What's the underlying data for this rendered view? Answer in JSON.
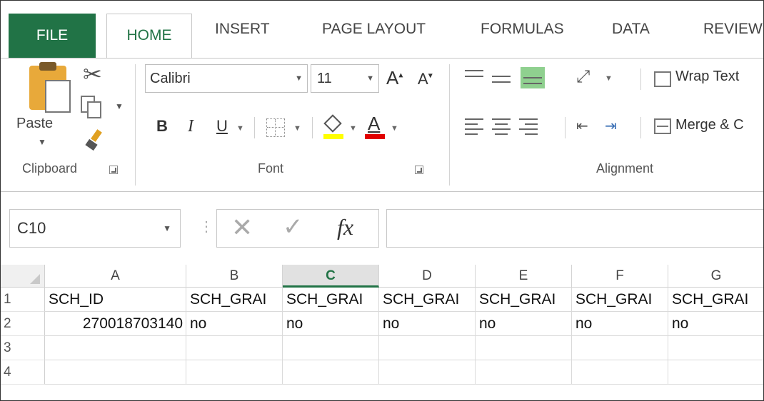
{
  "tabs": [
    "FILE",
    "HOME",
    "INSERT",
    "PAGE LAYOUT",
    "FORMULAS",
    "DATA",
    "REVIEW"
  ],
  "ribbon": {
    "clipboard": {
      "paste_label": "Paste",
      "group_label": "Clipboard"
    },
    "font": {
      "font_name": "Calibri",
      "font_size": "11",
      "bold": "B",
      "italic": "I",
      "underline": "U",
      "grow": "A",
      "shrink": "A",
      "font_color_letter": "A",
      "group_label": "Font",
      "fill_color": "#ffff00",
      "font_color": "#e00000"
    },
    "alignment": {
      "wrap_text": "Wrap Text",
      "merge": "Merge & C",
      "group_label": "Alignment"
    }
  },
  "formula_bar": {
    "name_box": "C10",
    "fx": "fx",
    "content": ""
  },
  "sheet": {
    "columns": [
      "A",
      "B",
      "C",
      "D",
      "E",
      "F",
      "G"
    ],
    "selected_column": "C",
    "rows": [
      {
        "num": "1",
        "cells": [
          "SCH_ID",
          "SCH_GRAI",
          "SCH_GRAI",
          "SCH_GRAI",
          "SCH_GRAI",
          "SCH_GRAI",
          "SCH_GRAI"
        ]
      },
      {
        "num": "2",
        "cells": [
          "270018703140",
          "no",
          "no",
          "no",
          "no",
          "no",
          "no"
        ]
      },
      {
        "num": "3",
        "cells": [
          "",
          "",
          "",
          "",
          "",
          "",
          ""
        ]
      },
      {
        "num": "4",
        "cells": [
          "",
          "",
          "",
          "",
          "",
          "",
          ""
        ]
      }
    ]
  },
  "colors": {
    "accent": "#217346"
  }
}
